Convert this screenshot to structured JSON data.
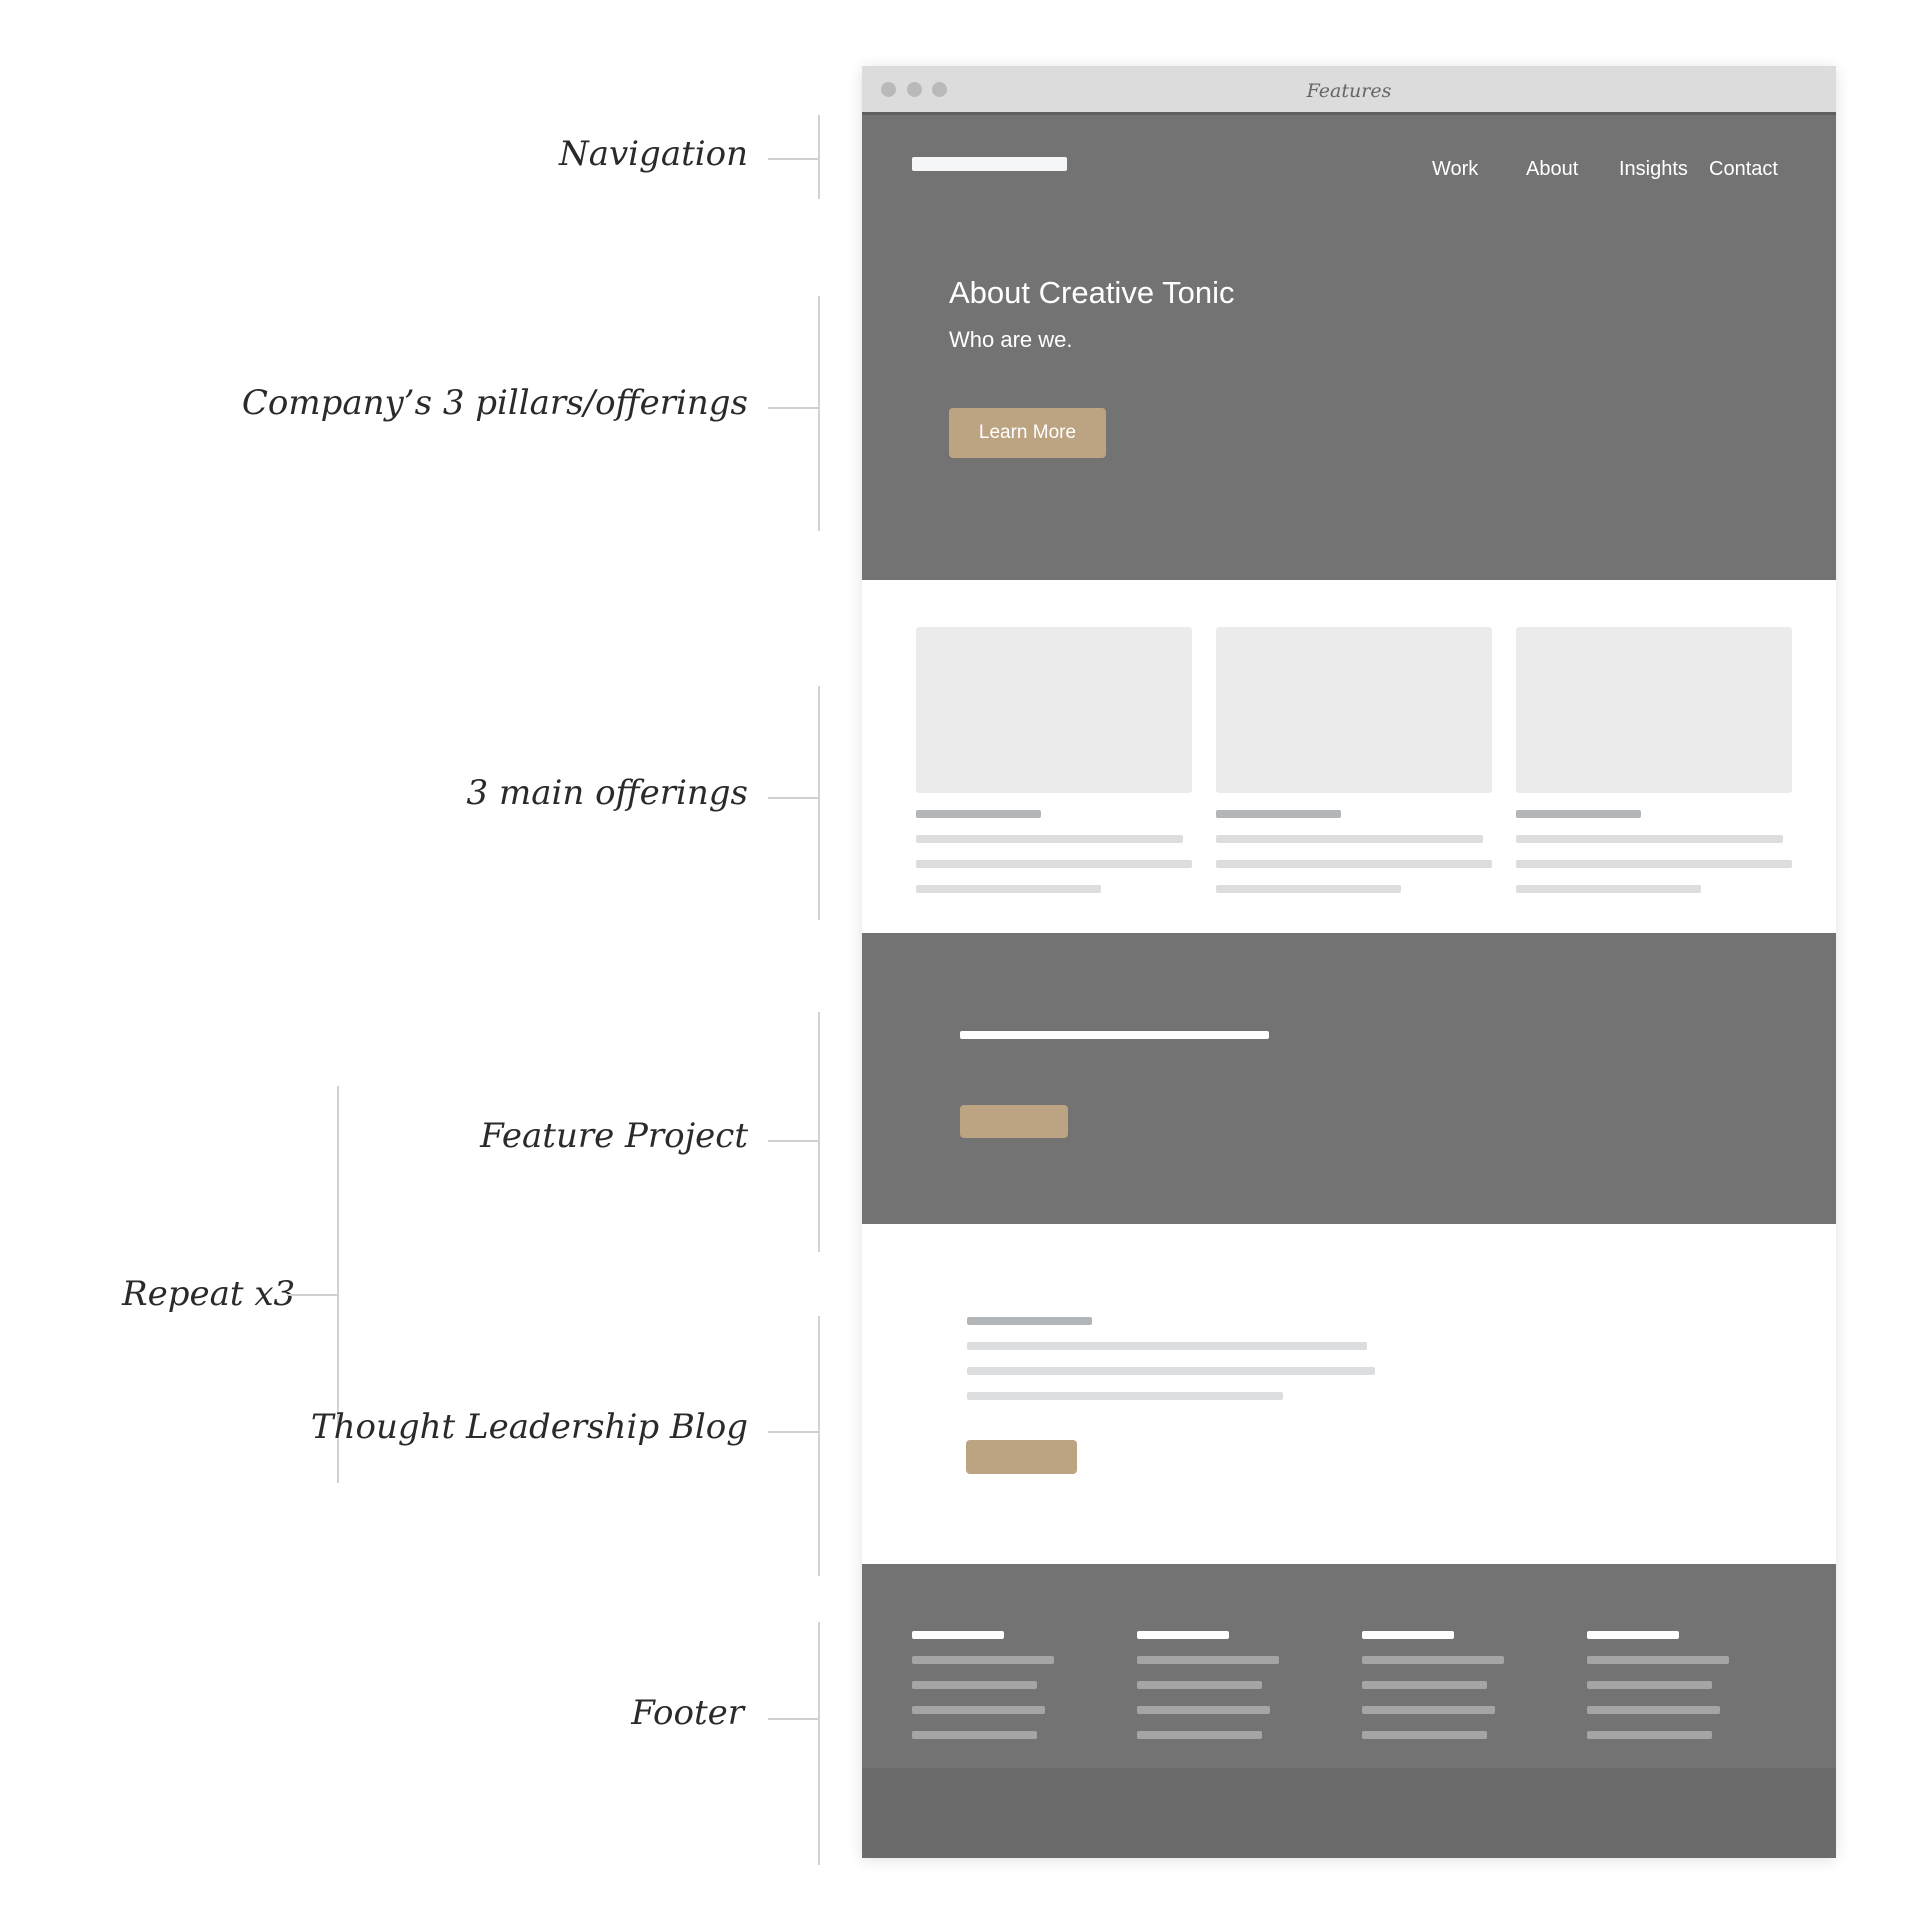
{
  "annotations": {
    "navigation": "Navigation",
    "pillars": "Company’s 3 pillars/offerings",
    "offerings": "3 main offerings",
    "feature_project": "Feature Project",
    "repeat": "Repeat x3",
    "blog": "Thought Leadership Blog",
    "footer": "Footer"
  },
  "browser": {
    "tab_title": "Features"
  },
  "nav": {
    "links": [
      "Work",
      "About",
      "Insights",
      "Contact"
    ]
  },
  "hero": {
    "title": "About Creative Tonic",
    "subtitle": "Who are we.",
    "button_label": "Learn More"
  },
  "colors": {
    "dark_section": "#737373",
    "accent_button": "#bca382",
    "placeholder_image": "#ebebeb"
  }
}
